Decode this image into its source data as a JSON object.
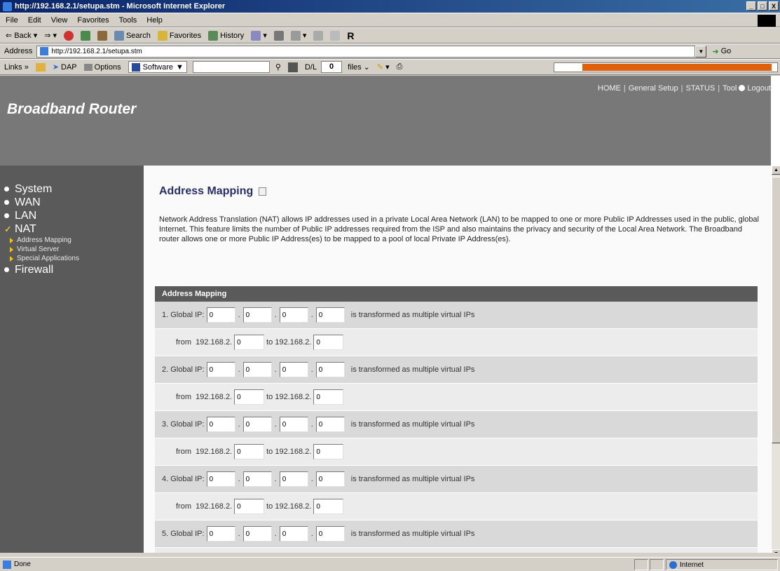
{
  "window": {
    "title": "http://192.168.2.1/setupa.stm - Microsoft Internet Explorer",
    "buttons": [
      "_",
      "□",
      "X"
    ]
  },
  "menubar": [
    "File",
    "Edit",
    "View",
    "Favorites",
    "Tools",
    "Help"
  ],
  "toolbar": {
    "back": "Back",
    "search": "Search",
    "favorites": "Favorites",
    "history": "History"
  },
  "addressbar": {
    "label": "Address",
    "url": "http://192.168.2.1/setupa.stm",
    "go": "Go"
  },
  "linksbar": {
    "links": "Links",
    "dap": "DAP",
    "options": "Options",
    "software": "Software",
    "dl": "D/L",
    "count": "0",
    "files": "files"
  },
  "router": {
    "brand": "Broadband Router",
    "nav": {
      "home": "HOME",
      "general_setup": "General Setup",
      "status": "STATUS",
      "tool": "Tool",
      "logout": "Logout"
    }
  },
  "sidebar": {
    "items": [
      {
        "label": "System"
      },
      {
        "label": "WAN"
      },
      {
        "label": "LAN"
      },
      {
        "label": "NAT"
      },
      {
        "label": "Firewall"
      }
    ],
    "nat_subitems": [
      "Address Mapping",
      "Virtual Server",
      "Special Applications"
    ]
  },
  "content": {
    "title": "Address Mapping",
    "description": "Network Address Translation (NAT) allows IP addresses used in a private Local Area Network (LAN) to be mapped to one or more Public IP Addresses used in the public, global Internet. This feature limits the number of Public IP addresses required from the ISP and also maintains the privacy and security of the Local Area Network. The Broadband router allows one or more Public IP Address(es) to be mapped to a pool of local Private IP Address(es).",
    "table_header": "Address Mapping",
    "global_ip_label": "Global IP:",
    "transformed_text": "is transformed as multiple virtual IPs",
    "from_label": "from",
    "to_label": "to",
    "subnet_prefix": "192.168.2.",
    "entries": [
      {
        "num": "1.",
        "ip": [
          "0",
          "0",
          "0",
          "0"
        ],
        "from": "0",
        "to": "0"
      },
      {
        "num": "2.",
        "ip": [
          "0",
          "0",
          "0",
          "0"
        ],
        "from": "0",
        "to": "0"
      },
      {
        "num": "3.",
        "ip": [
          "0",
          "0",
          "0",
          "0"
        ],
        "from": "0",
        "to": "0"
      },
      {
        "num": "4.",
        "ip": [
          "0",
          "0",
          "0",
          "0"
        ],
        "from": "0",
        "to": "0"
      },
      {
        "num": "5.",
        "ip": [
          "0",
          "0",
          "0",
          "0"
        ]
      }
    ]
  },
  "statusbar": {
    "left": "Done",
    "zone": "Internet"
  }
}
